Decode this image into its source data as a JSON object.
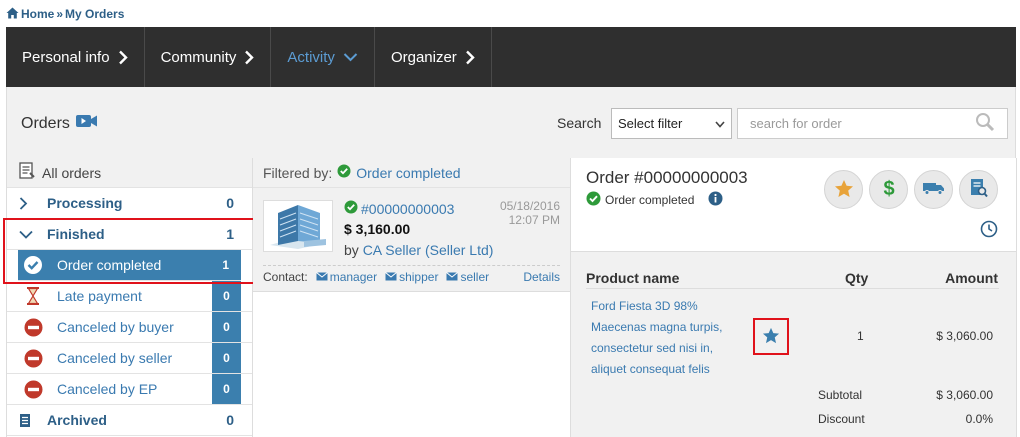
{
  "breadcrumb": {
    "home": "Home",
    "separator": "»",
    "current": "My Orders"
  },
  "nav": [
    {
      "label": "Personal info",
      "active": false
    },
    {
      "label": "Community",
      "active": false
    },
    {
      "label": "Activity",
      "active": true
    },
    {
      "label": "Organizer",
      "active": false
    }
  ],
  "orders_bar": {
    "title": "Orders",
    "search_label": "Search",
    "filter_selected": "Select filter",
    "search_placeholder": "search for order"
  },
  "left": {
    "all_orders": "All orders",
    "processing": {
      "label": "Processing",
      "count": "0"
    },
    "finished": {
      "label": "Finished",
      "count": "1"
    },
    "sub": [
      {
        "label": "Order completed",
        "count": "1"
      },
      {
        "label": "Late payment",
        "count": "0"
      },
      {
        "label": "Canceled by buyer",
        "count": "0"
      },
      {
        "label": "Canceled by seller",
        "count": "0"
      },
      {
        "label": "Canceled by EP",
        "count": "0"
      }
    ],
    "archived": {
      "label": "Archived",
      "count": "0"
    }
  },
  "middle": {
    "filtered_by": "Filtered by:",
    "filter_value": "Order completed",
    "order": {
      "number": "#00000000003",
      "date": "05/18/2016",
      "time": "12:07 PM",
      "price": "$ 3,160.00",
      "by": "by",
      "seller": "CA Seller",
      "company": "(Seller Ltd)",
      "contact_label": "Contact:",
      "contact_manager": "manager",
      "contact_shipper": "shipper",
      "contact_seller": "seller",
      "details": "Details"
    }
  },
  "right": {
    "title": "Order #00000000003",
    "status": "Order completed",
    "col_product": "Product name",
    "col_qty": "Qty",
    "col_amount": "Amount",
    "product_lines": [
      "Ford Fiesta 3D 98%",
      "Maecenas magna turpis,",
      "consectetur sed nisi in,",
      "aliquet consequat felis"
    ],
    "qty": "1",
    "amount": "$ 3,060.00",
    "subtotal_label": "Subtotal",
    "subtotal": "$ 3,060.00",
    "discount_label": "Discount",
    "discount": "0.0%"
  },
  "colors": {
    "accent": "#3b7fae",
    "link": "#3a7ab0",
    "success": "#2e9a3a",
    "highlight": "#e0121b",
    "star": "#e8a33a",
    "nav_bg": "#2f2f2f"
  },
  "icons": [
    "home-icon",
    "chevron-right-icon",
    "chevron-down-icon",
    "video-icon",
    "search-icon",
    "orders-list-icon",
    "check-circle-icon",
    "hourglass-icon",
    "minus-circle-icon",
    "archive-icon",
    "envelope-icon",
    "star-icon",
    "dollar-icon",
    "truck-icon",
    "document-search-icon",
    "info-icon",
    "clock-icon"
  ]
}
